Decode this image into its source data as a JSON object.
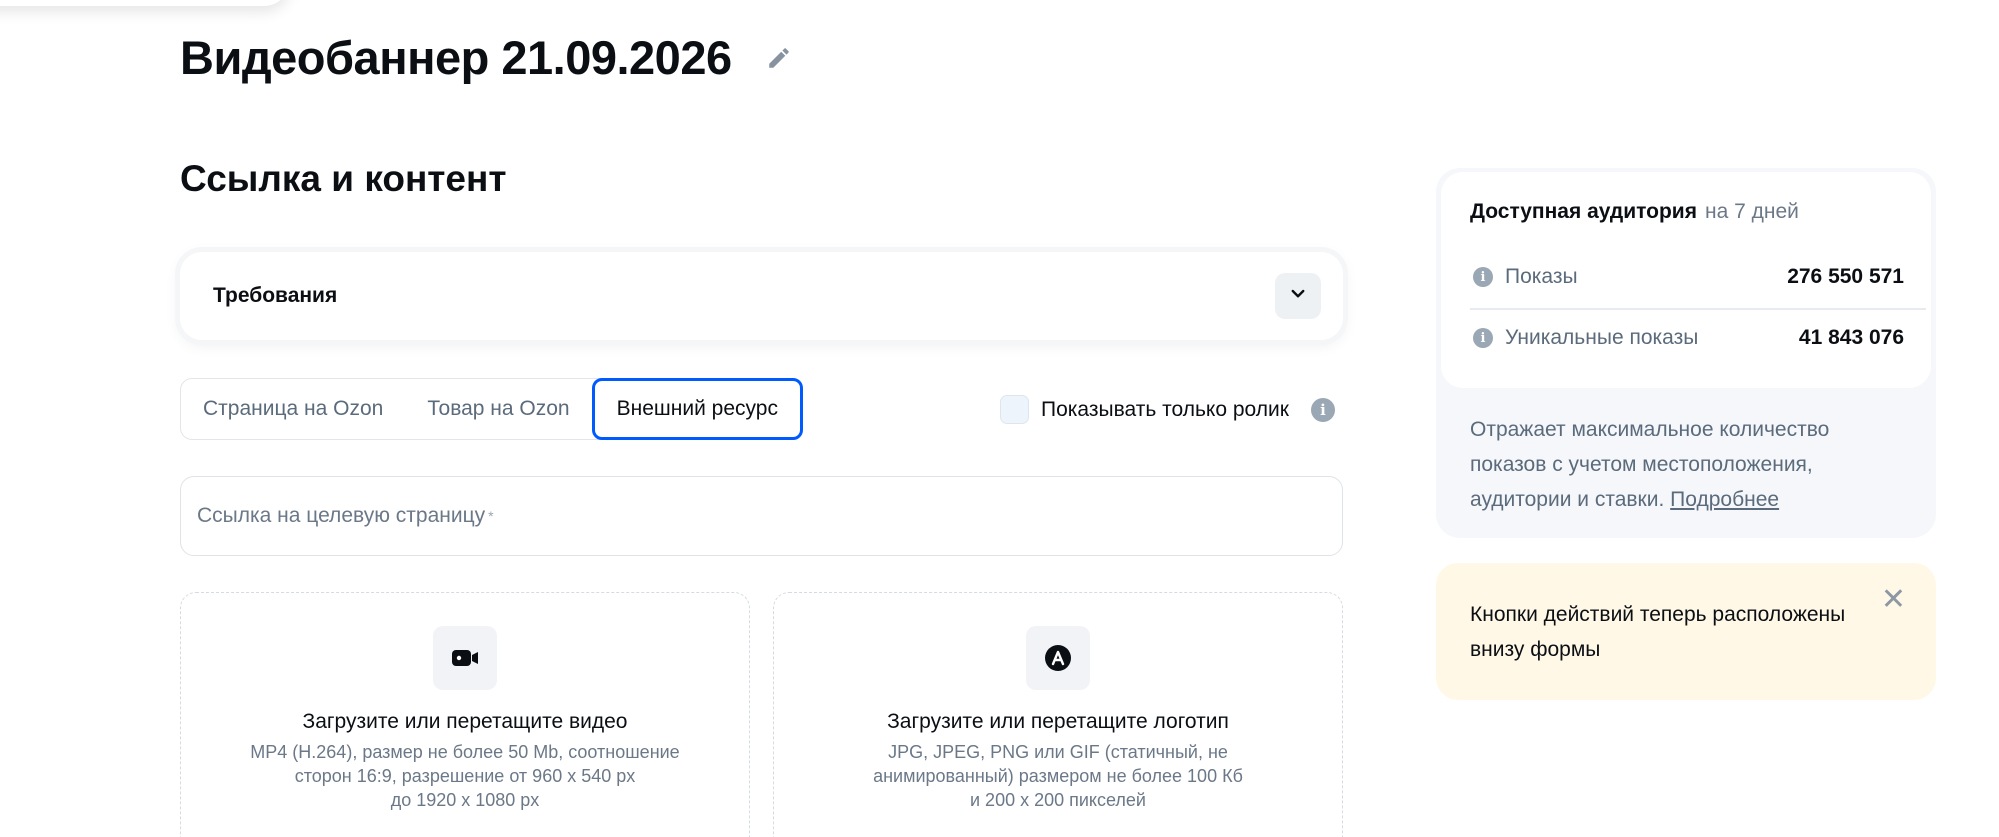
{
  "header": {
    "title": "Видеобаннер 21.09.2026"
  },
  "section": {
    "title": "Ссылка и контент"
  },
  "requirements": {
    "label": "Требования"
  },
  "tabs": [
    {
      "label": "Страница на Ozon",
      "active": false
    },
    {
      "label": "Товар на Ozon",
      "active": false
    },
    {
      "label": "Внешний ресурс",
      "active": true
    }
  ],
  "only_video": {
    "label": "Показывать только ролик",
    "checked": false
  },
  "url_field": {
    "placeholder": "Ссылка на целевую страницу",
    "required_mark": "*"
  },
  "upload_video": {
    "title": "Загрузите или перетащите видео",
    "desc_1": "MP4 (H.264), размер не более 50 Mb, соотношение",
    "desc_2": "сторон 16:9, разрешение от 960 x 540 px",
    "desc_3": "до 1920 x 1080 px"
  },
  "upload_logo": {
    "title": "Загрузите или перетащите логотип",
    "desc_1": "JPG, JPEG, PNG или GIF (статичный, не",
    "desc_2": "анимированный) размером не более 100 Кб",
    "desc_3": "и 200 x 200 пикселей"
  },
  "audience": {
    "title": "Доступная аудитория",
    "period": "на 7 дней",
    "rows": [
      {
        "label": "Показы",
        "value": "276 550 571"
      },
      {
        "label": "Уникальные показы",
        "value": "41 843 076"
      }
    ],
    "note": "Отражает максимальное количество показов с учетом местоположения, аудитории и ставки.",
    "more_link": "Подробнее"
  },
  "notice": {
    "text": "Кнопки действий теперь расположены внизу формы",
    "close": "✕"
  },
  "colors": {
    "accent": "#005bff",
    "notice_bg": "#fff8e6",
    "panel_bg": "#f5f7fa"
  },
  "icons": {
    "edit": "pencil-icon",
    "chevron": "chevron-down-icon",
    "video": "video-camera-icon",
    "logo": "logo-a-icon",
    "info": "info-icon",
    "close": "close-icon"
  }
}
